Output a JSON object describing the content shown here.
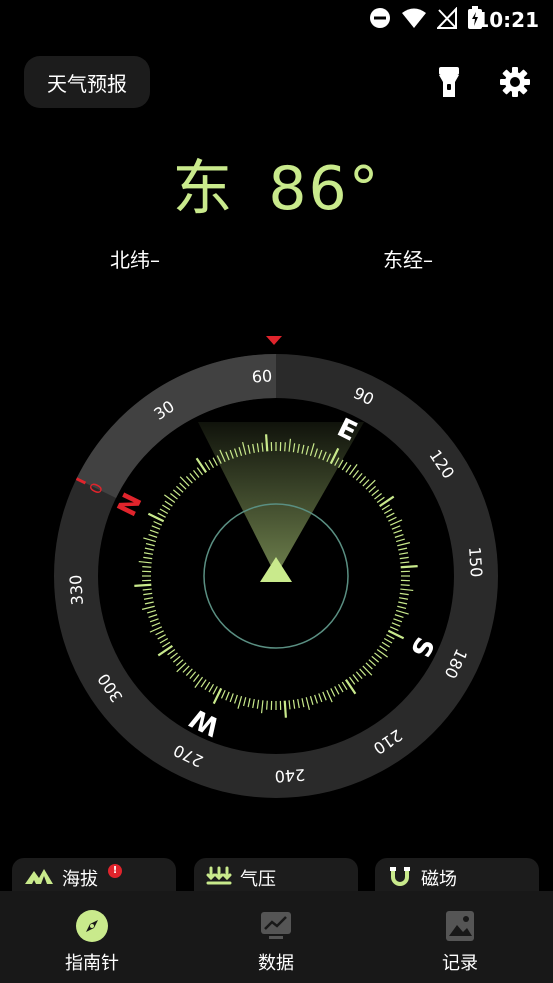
{
  "status": {
    "time": "10:21"
  },
  "header": {
    "weather_button": "天气预报"
  },
  "reading": {
    "direction": "东",
    "degrees": "86°",
    "latitude": "北纬–",
    "longitude": "东经–"
  },
  "compass": {
    "heading_value": 86,
    "degree_labels": [
      "0",
      "30",
      "60",
      "90",
      "120",
      "150",
      "180",
      "210",
      "240",
      "270",
      "300",
      "330"
    ],
    "cardinals": [
      "N",
      "E",
      "S",
      "W"
    ],
    "accent": "#c9ea8c",
    "north_color": "#e0242c"
  },
  "cards": [
    {
      "label": "海拔",
      "badge": "!"
    },
    {
      "label": "气压"
    },
    {
      "label": "磁场"
    }
  ],
  "nav": [
    {
      "label": "指南针",
      "active": true
    },
    {
      "label": "数据"
    },
    {
      "label": "记录"
    }
  ]
}
